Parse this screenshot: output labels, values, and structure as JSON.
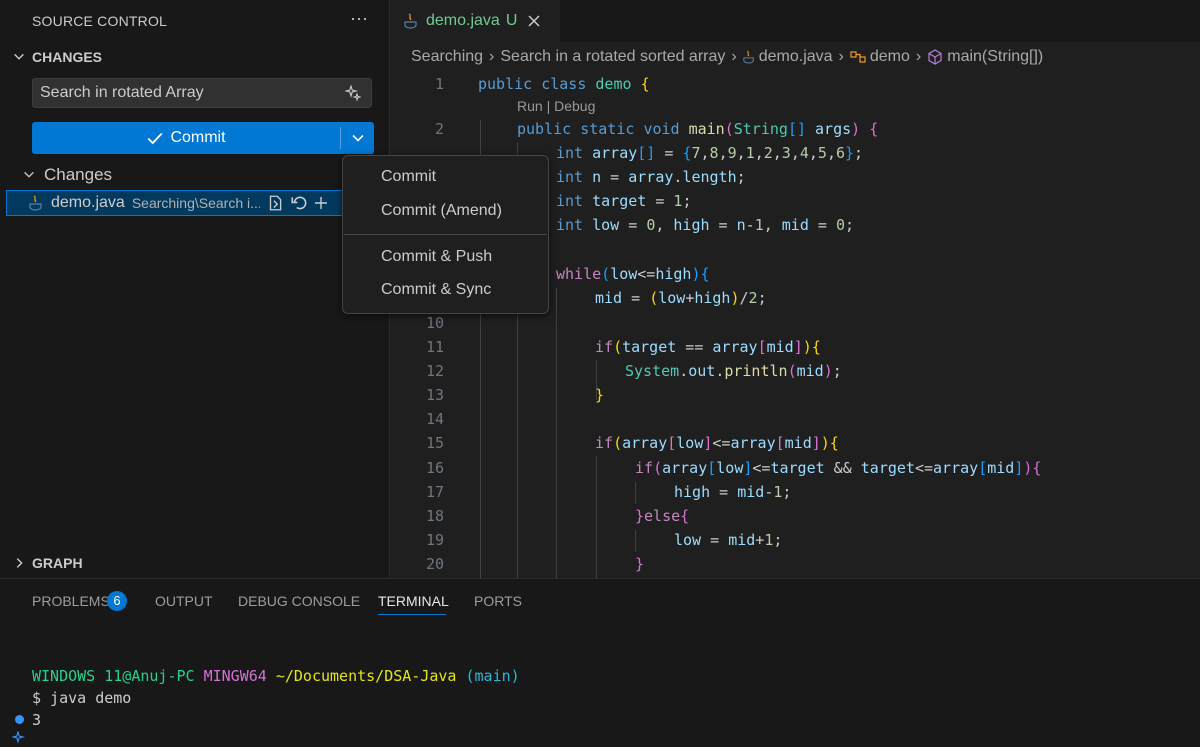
{
  "sidebar": {
    "title": "SOURCE CONTROL",
    "more": "···",
    "changes_header": "CHANGES",
    "message_value": "Search in rotated Array",
    "commit_label": "Commit",
    "changes_group": "Changes",
    "file": {
      "name": "demo.java",
      "path": "Searching\\Search i..."
    },
    "graph_header": "GRAPH"
  },
  "editor": {
    "tab": {
      "name": "demo.java",
      "status": "U"
    },
    "breadcrumb": [
      "Searching",
      "Search in a rotated sorted array",
      "demo.java",
      "demo",
      "main(String[])"
    ],
    "codelens": "Run | Debug",
    "line_numbers": [
      "1",
      "2",
      "10",
      "11",
      "12",
      "13",
      "14",
      "15",
      "16",
      "17",
      "18",
      "19",
      "20"
    ]
  },
  "menu": {
    "items": [
      "Commit",
      "Commit (Amend)",
      "Commit & Push",
      "Commit & Sync"
    ]
  },
  "panel": {
    "tabs": [
      "PROBLEMS",
      "OUTPUT",
      "DEBUG CONSOLE",
      "TERMINAL",
      "PORTS"
    ],
    "problems_count": "6",
    "terminal": {
      "user": "WINDOWS 11@Anuj-PC",
      "shell": "MINGW64",
      "path": "~/Documents/DSA-Java",
      "branch": "(main)",
      "command": "$ java demo",
      "output": "3"
    }
  },
  "colors": {
    "accent": "#0078d4",
    "untracked": "#73c991",
    "terminal_user": "#23d18b",
    "terminal_shell": "#d670d6",
    "terminal_path": "#e5e510",
    "terminal_branch": "#29b8db"
  }
}
